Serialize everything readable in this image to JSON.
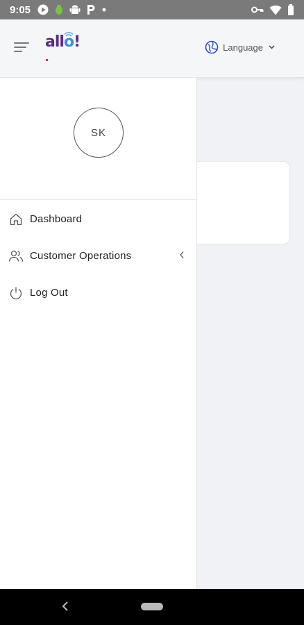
{
  "status_bar": {
    "time": "9:05",
    "left_icons": [
      "play-icon",
      "bug-icon",
      "android-icon",
      "parking-icon",
      "dot-icon"
    ],
    "right_icons": [
      "vpn-key-icon",
      "wifi-icon",
      "battery-icon"
    ]
  },
  "header": {
    "logo_text_a": "all",
    "logo_text_o": "o",
    "logo_text_bang": "!",
    "language_label": "Language"
  },
  "drawer": {
    "avatar_initials": "SK",
    "items": [
      {
        "label": "Dashboard",
        "icon": "home-icon"
      },
      {
        "label": "Customer Operations",
        "icon": "users-icon",
        "has_submenu": true
      },
      {
        "label": "Log Out",
        "icon": "power-icon"
      }
    ]
  },
  "colors": {
    "status_bar": "#7a7a7a",
    "logo_purple": "#5a2d82",
    "logo_blue": "#3a8fd8",
    "globe_blue": "#2f4db8"
  }
}
